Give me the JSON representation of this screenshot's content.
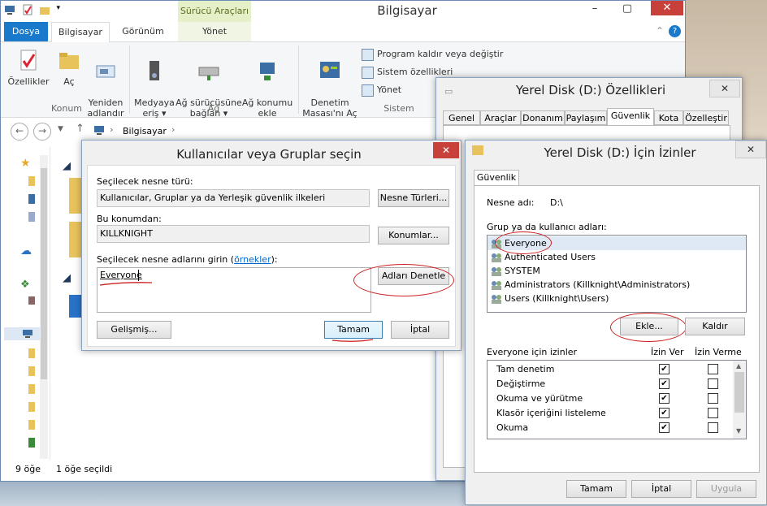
{
  "explorer": {
    "title": "Bilgisayar",
    "context_tab_header": "Sürücü Araçları",
    "tabs": [
      "Dosya",
      "Bilgisayar",
      "Görünüm",
      "Yönet"
    ],
    "ribbon": {
      "location_group": {
        "label": "Konum",
        "buttons": [
          "Özellikler",
          "Aç",
          "Yeniden\nadlandır"
        ]
      },
      "network_group": {
        "label": "Ağ",
        "buttons": [
          "Medyaya\neriş ▾",
          "Ağ sürücüsüne\nbağlan ▾",
          "Ağ konumu\nekle"
        ]
      },
      "system_group": {
        "label": "Sistem",
        "big_button": "Denetim\nMasası'nı Aç",
        "commands": [
          "Program kaldır veya değiştir",
          "Sistem özellikleri",
          "Yönet"
        ]
      }
    },
    "breadcrumb": "Bilgisayar",
    "status": {
      "count": "9 öğe",
      "selected": "1 öğe seçildi"
    }
  },
  "select_dialog": {
    "title": "Kullanıcılar veya Gruplar seçin",
    "object_type_label": "Seçilecek nesne türü:",
    "object_type_value": "Kullanıcılar, Gruplar ya da Yerleşik güvenlik ilkeleri",
    "object_types_button": "Nesne Türleri...",
    "location_label": "Bu konumdan:",
    "location_value": "KILLKNIGHT",
    "locations_button": "Konumlar...",
    "enter_names_label": "Seçilecek nesne adlarını girin (",
    "examples_link": "örnekler",
    "enter_names_suffix": "):",
    "names_value": "Everyone",
    "check_names_button": "Adları Denetle",
    "advanced_button": "Gelişmiş...",
    "ok_button": "Tamam",
    "cancel_button": "İptal"
  },
  "properties_dialog": {
    "title": "Yerel Disk (D:) Özellikleri",
    "tabs": [
      "Genel",
      "Araçlar",
      "Donanım",
      "Paylaşım",
      "Güvenlik",
      "Kota",
      "Özelleştir"
    ],
    "active_tab": "Güvenlik"
  },
  "permissions_dialog": {
    "title": "Yerel Disk (D:) İçin İzinler",
    "tab": "Güvenlik",
    "object_name_label": "Nesne adı:",
    "object_name_value": "D:\\",
    "groups_label": "Grup ya da kullanıcı adları:",
    "groups": [
      "Everyone",
      "Authenticated Users",
      "SYSTEM",
      "Administrators (Killknight\\Administrators)",
      "Users (Killknight\\Users)"
    ],
    "add_button": "Ekle...",
    "remove_button": "Kaldır",
    "permissions_for_label": "Everyone için izinler",
    "allow_header": "İzin Ver",
    "deny_header": "İzin Verme",
    "permissions": [
      {
        "name": "Tam denetim",
        "allow": true,
        "deny": false
      },
      {
        "name": "Değiştirme",
        "allow": true,
        "deny": false
      },
      {
        "name": "Okuma ve yürütme",
        "allow": true,
        "deny": false
      },
      {
        "name": "Klasör içeriğini listeleme",
        "allow": true,
        "deny": false
      },
      {
        "name": "Okuma",
        "allow": true,
        "deny": false
      }
    ],
    "ok_button": "Tamam",
    "cancel_button": "İptal",
    "apply_button": "Uygula"
  },
  "colors": {
    "accent": "#1979ca",
    "annotation_red": "#cc1f1f"
  }
}
